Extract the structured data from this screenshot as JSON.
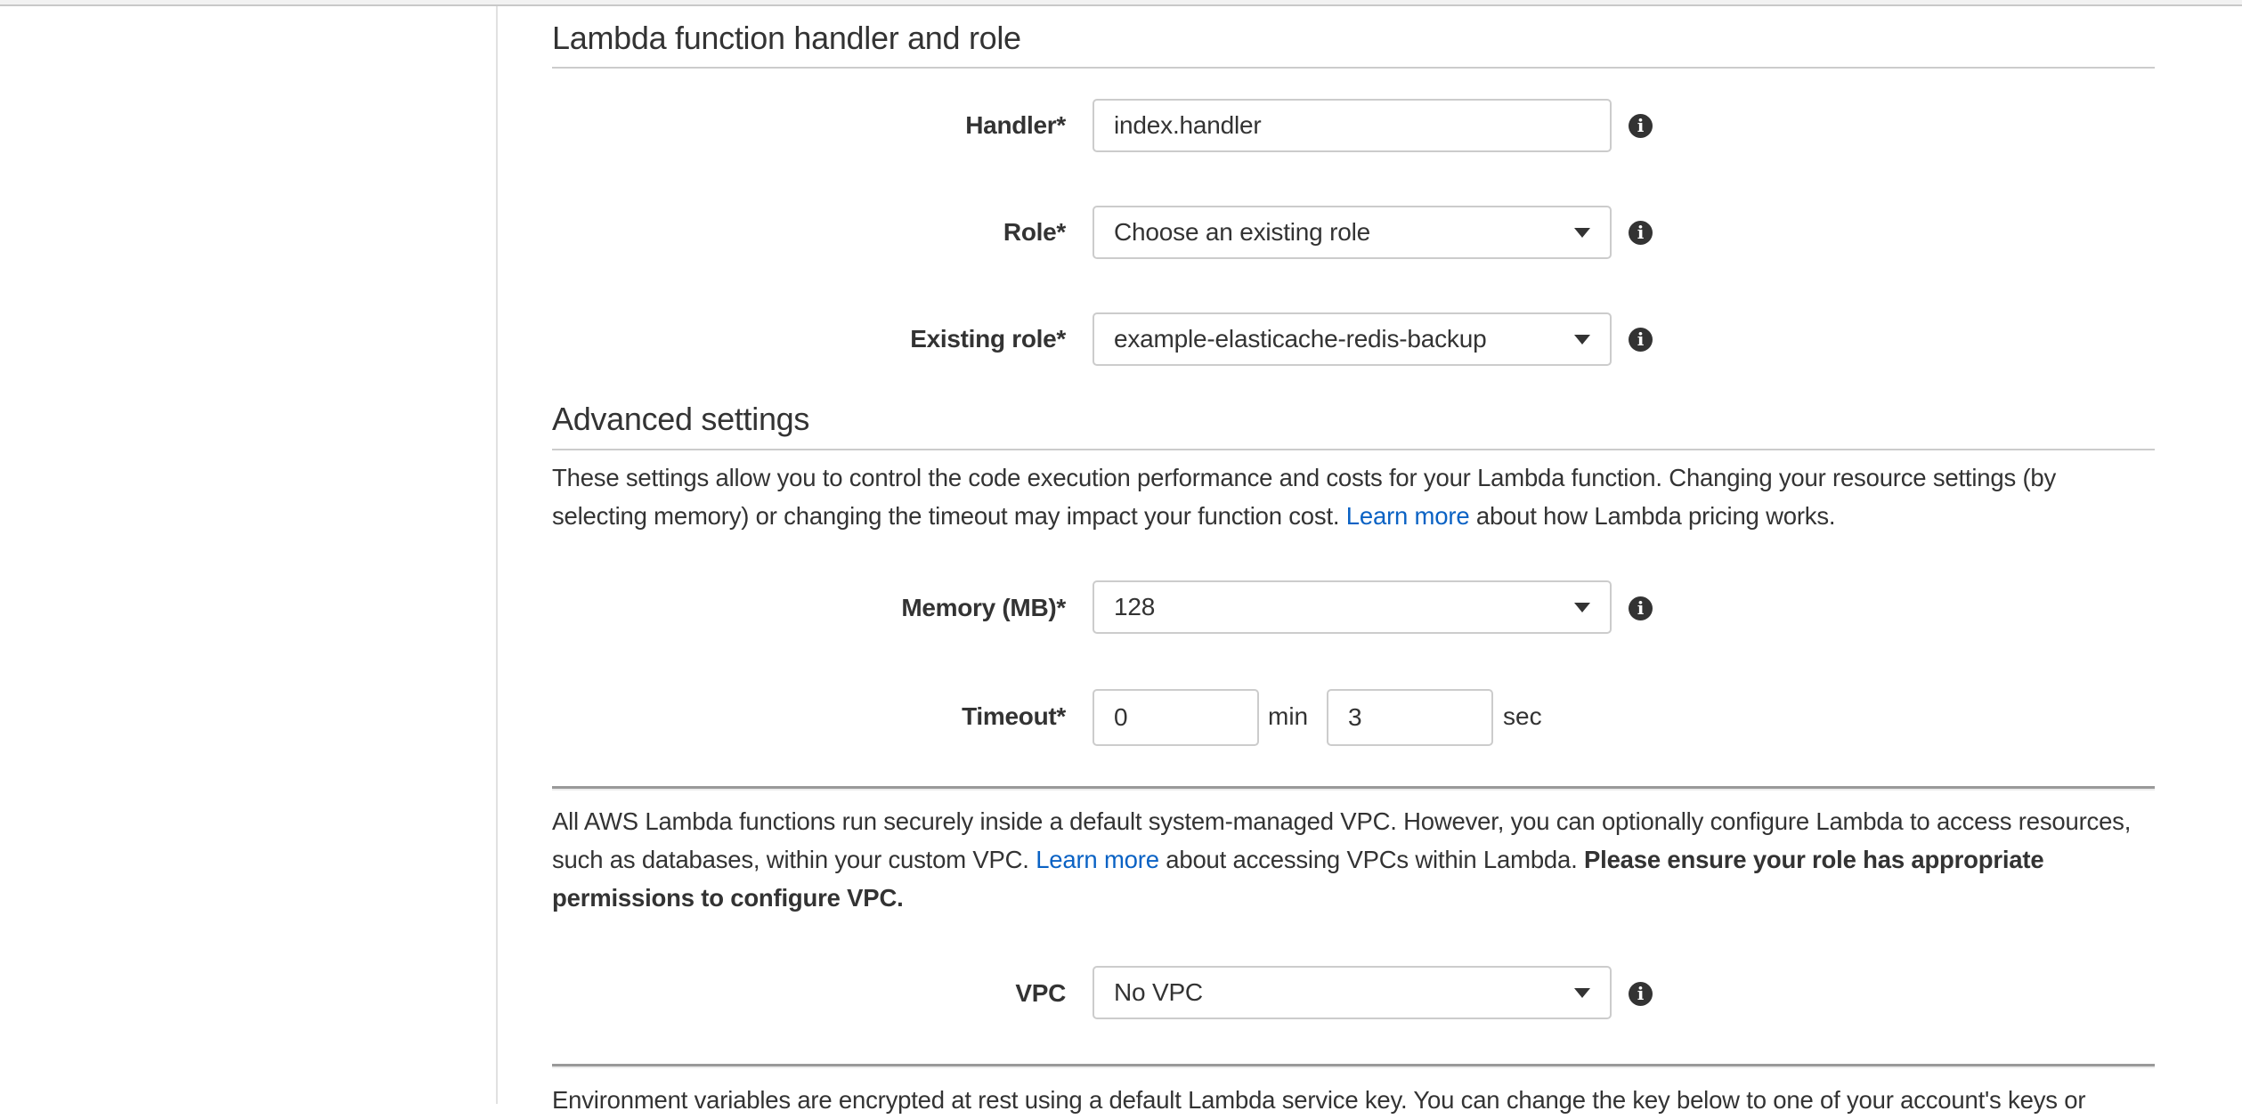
{
  "handler_role_section": {
    "title": "Lambda function handler and role",
    "handler": {
      "label": "Handler*",
      "value": "index.handler"
    },
    "role": {
      "label": "Role*",
      "value": "Choose an existing role"
    },
    "existing_role": {
      "label": "Existing role*",
      "value": "example-elasticache-redis-backup"
    }
  },
  "advanced_section": {
    "title": "Advanced settings",
    "description_pre": "These settings allow you to control the code execution performance and costs for your Lambda function. Changing your resource settings (by selecting memory) or changing the timeout may impact your function cost. ",
    "learn_more": "Learn more",
    "description_post": " about how Lambda pricing works.",
    "memory": {
      "label": "Memory (MB)*",
      "value": "128"
    },
    "timeout": {
      "label": "Timeout*",
      "min_value": "0",
      "min_unit": "min",
      "sec_value": "3",
      "sec_unit": "sec"
    }
  },
  "vpc_section": {
    "description_pre": "All AWS Lambda functions run securely inside a default system-managed VPC. However, you can optionally configure Lambda to access resources, such as databases, within your custom VPC. ",
    "learn_more": "Learn more",
    "description_mid": " about accessing VPCs within Lambda. ",
    "description_bold": "Please ensure your role has appropriate permissions to configure VPC.",
    "vpc": {
      "label": "VPC",
      "value": "No VPC"
    }
  },
  "env_section": {
    "description": "Environment variables are encrypted at rest using a default Lambda service key. You can change the key below to one of your account's keys or"
  },
  "icons": {
    "info": "i"
  },
  "colors": {
    "link": "#0a62c4",
    "text": "#333333",
    "border": "#cccccc"
  }
}
